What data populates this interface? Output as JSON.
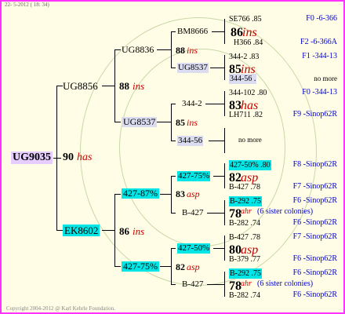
{
  "header": "22- 5-2012 ( 18: 34)",
  "footer": "Copyright 2004-2012 @ Karl Kehrle Foundation.",
  "root": {
    "id": "UG9035",
    "year": "90",
    "queen": "has"
  },
  "l1": [
    {
      "id": "UG8856",
      "year": "88",
      "queen": "ins"
    },
    {
      "id": "EK8602",
      "year": "86",
      "queen": "ins"
    }
  ],
  "l2": [
    {
      "id": "UG8836",
      "year": "88",
      "queen": "ins"
    },
    {
      "id": "UG8537",
      "year": "85",
      "queen": "ins"
    },
    {
      "id": "427-87%",
      "year": "83",
      "queen": "asp"
    },
    {
      "id": "427-75%",
      "year": "82",
      "queen": "asp"
    }
  ],
  "l3": [
    {
      "id": "BM8666",
      "year": "",
      "queen": ""
    },
    {
      "id": "UG8537",
      "year": "",
      "queen": ""
    },
    {
      "id": "344-2",
      "year": "",
      "queen": ""
    },
    {
      "id": "344-56",
      "year": "",
      "queen": ""
    },
    {
      "id": "427-75%",
      "year": "",
      "queen": ""
    },
    {
      "id": "B-427",
      "year": "",
      "queen": ""
    },
    {
      "id": "427-50%",
      "year": "",
      "queen": ""
    },
    {
      "id": "B-427",
      "year": "",
      "queen": ""
    }
  ],
  "l4": [
    {
      "a": "SE766 .85",
      "b": "86",
      "q": "ins",
      "c": "H366 .84",
      "ra": "F0 -6-366",
      "rc": "F2 -6-366A"
    },
    {
      "a": "344-2 .83",
      "b": "85",
      "q": "ins",
      "c": "344-56 .",
      "ra": "F1 -344-13",
      "rc": "no more"
    },
    {
      "a": "344-102 .80",
      "b": "83",
      "q": "has",
      "c": "LH711 .82",
      "ra": "F0 -344-13",
      "rc": "F9 -Sinop62R"
    },
    {
      "a": "",
      "b": "",
      "q": "",
      "c": "",
      "mid": "no more",
      "ra": "",
      "rc": ""
    },
    {
      "a": "427-50% .80",
      "b": "82",
      "q": "asp",
      "c": "B-427 .78",
      "ra": "F8 -Sinop62R",
      "rc": "F7 -Sinop62R"
    },
    {
      "a": "B-292 .75",
      "b": "78",
      "q": "ahr",
      "sister": "(6 sister colonies)",
      "c": "B-282 .74",
      "ra": "F6 -Sinop62R",
      "rc": "F6 -Sinop62R"
    },
    {
      "a": "B-427 .78",
      "b": "80",
      "q": "asp",
      "c": "B-379 .77",
      "ra": "F7 -Sinop62R",
      "rc": "F6 -Sinop62R"
    },
    {
      "a": "B-292 .75",
      "b": "78",
      "q": "ahr",
      "sister": "(6 sister colonies)",
      "c": "B-282 .74",
      "ra": "F6 -Sinop62R",
      "rc": "F6 -Sinop62R"
    }
  ]
}
